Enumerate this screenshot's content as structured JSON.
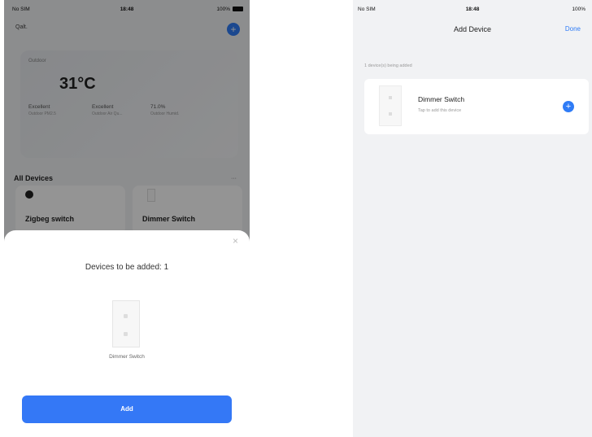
{
  "left": {
    "status": {
      "carrier": "No SIM",
      "time": "18:48",
      "right": "100%"
    },
    "home": {
      "switcher": "Qalt."
    },
    "weather": {
      "label": "Outdoor",
      "temp": "31°C",
      "columns": [
        {
          "title": "Excellent",
          "value": "Outdoor PM2.5"
        },
        {
          "title": "Excellent",
          "value": "Outdoor Air Qu..."
        },
        {
          "title": "71.0%",
          "value": "Outdoor Humid."
        }
      ]
    },
    "section": {
      "title": "All Devices",
      "more": "···"
    },
    "devices": [
      "Zigbeg switch",
      "Dimmer Switch"
    ],
    "sheet": {
      "close": "×",
      "title": "Devices to be added: 1",
      "device_name": "Dimmer Switch",
      "add_label": "Add"
    },
    "icons": {
      "plus": "+",
      "close": "×"
    },
    "colors": {
      "accent": "#3478f6",
      "dim": "rgba(0,0,0,0.42)"
    }
  },
  "right": {
    "status": {
      "carrier": "No SIM",
      "time": "18:48",
      "right": "100%"
    },
    "nav": {
      "title": "Add Device",
      "done": "Done"
    },
    "section_label": "1 device(s) being added",
    "device": {
      "name": "Dimmer Switch",
      "subtitle": "Tap to add this device"
    },
    "icons": {
      "add": "+"
    }
  }
}
